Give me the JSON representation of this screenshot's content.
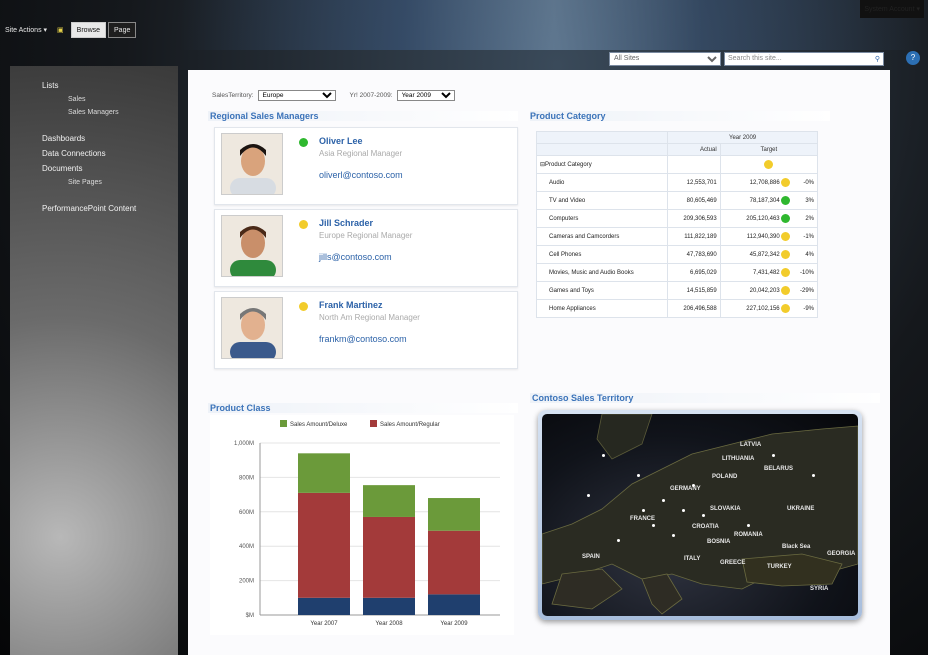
{
  "ribbon": {
    "site_actions": "Site Actions",
    "tabs": [
      "Browse",
      "Page"
    ],
    "system_account": "System Account"
  },
  "search": {
    "scope": "All Sites",
    "placeholder": "Search this site..."
  },
  "leftnav": {
    "groups": [
      {
        "head": "Lists",
        "items": [
          "Sales",
          "Sales Managers"
        ]
      },
      {
        "head": "Dashboards",
        "items": []
      },
      {
        "head": "Data Connections",
        "items": []
      },
      {
        "head": "Documents",
        "items": [
          "Site Pages"
        ]
      },
      {
        "head": "PerformancePoint Content",
        "items": []
      }
    ]
  },
  "filters": {
    "territory_label": "SalesTerritory:",
    "territory_value": "Europe",
    "year_label": "Yr! 2007-2009:",
    "year_value": "Year 2009"
  },
  "managers": {
    "title": "Regional Sales Managers",
    "people": [
      {
        "name": "Oliver Lee",
        "title": "Asia Regional Manager",
        "email": "oliverl@contoso.com",
        "status": "good"
      },
      {
        "name": "Jill Schrader",
        "title": "Europe Regional Manager",
        "email": "jills@contoso.com",
        "status": "warning"
      },
      {
        "name": "Frank Martinez",
        "title": "North Am Regional Manager",
        "email": "frankm@contoso.com",
        "status": "warning"
      }
    ]
  },
  "scorecard": {
    "title": "Product Category",
    "year": "Year 2009",
    "col_actual": "Actual",
    "col_target": "Target",
    "root": "Product Category",
    "rows": [
      {
        "name": "Audio",
        "actual": "12,553,701",
        "target": "12,708,886",
        "status": "warning",
        "pct": "-0%"
      },
      {
        "name": "TV and Video",
        "actual": "80,605,469",
        "target": "78,187,304",
        "status": "good",
        "pct": "3%"
      },
      {
        "name": "Computers",
        "actual": "209,306,593",
        "target": "205,120,463",
        "status": "good",
        "pct": "2%"
      },
      {
        "name": "Cameras and Camcorders",
        "actual": "111,822,189",
        "target": "112,940,390",
        "status": "warning",
        "pct": "-1%"
      },
      {
        "name": "Cell Phones",
        "actual": "47,783,690",
        "target": "45,872,342",
        "status": "warning",
        "pct": "4%"
      },
      {
        "name": "Movies, Music and Audio Books",
        "actual": "6,695,029",
        "target": "7,431,482",
        "status": "warning",
        "pct": "-10%"
      },
      {
        "name": "Games and Toys",
        "actual": "14,515,859",
        "target": "20,042,203",
        "status": "warning",
        "pct": "-29%"
      },
      {
        "name": "Home Appliances",
        "actual": "206,496,588",
        "target": "227,102,156",
        "status": "warning",
        "pct": "-9%"
      }
    ],
    "colors": {
      "good": "#2fb82f",
      "warning": "#f2cc2b"
    }
  },
  "product_class": {
    "title": "Product Class"
  },
  "chart_data": {
    "type": "bar",
    "stacked": true,
    "categories": [
      "Year 2007",
      "Year 2008",
      "Year 2009"
    ],
    "series": [
      {
        "name": "",
        "values": [
          100,
          100,
          120
        ],
        "color": "#1f3f6e"
      },
      {
        "name": "Sales Amount/Regular",
        "values": [
          610,
          470,
          370
        ],
        "color": "#a33a3a"
      },
      {
        "name": "Sales Amount/Deluxe",
        "values": [
          230,
          185,
          190
        ],
        "color": "#6b9a3a"
      }
    ],
    "y_ticks": [
      "$M",
      "200M",
      "400M",
      "600M",
      "800M",
      "1,000M"
    ],
    "ylim": [
      0,
      1000
    ],
    "legend": "top",
    "grid": true
  },
  "map": {
    "title": "Contoso Sales Territory",
    "labels": [
      "LATVIA",
      "LITHUANIA",
      "BELARUS",
      "POLAND",
      "GERMANY",
      "UKRAINE",
      "FRANCE",
      "SLOVAKIA",
      "CROATIA",
      "ROMANIA",
      "BOSNIA",
      "SPAIN",
      "ITALY",
      "GREECE",
      "Black Sea",
      "GEORGIA",
      "TURKEY",
      "SYRIA"
    ]
  }
}
